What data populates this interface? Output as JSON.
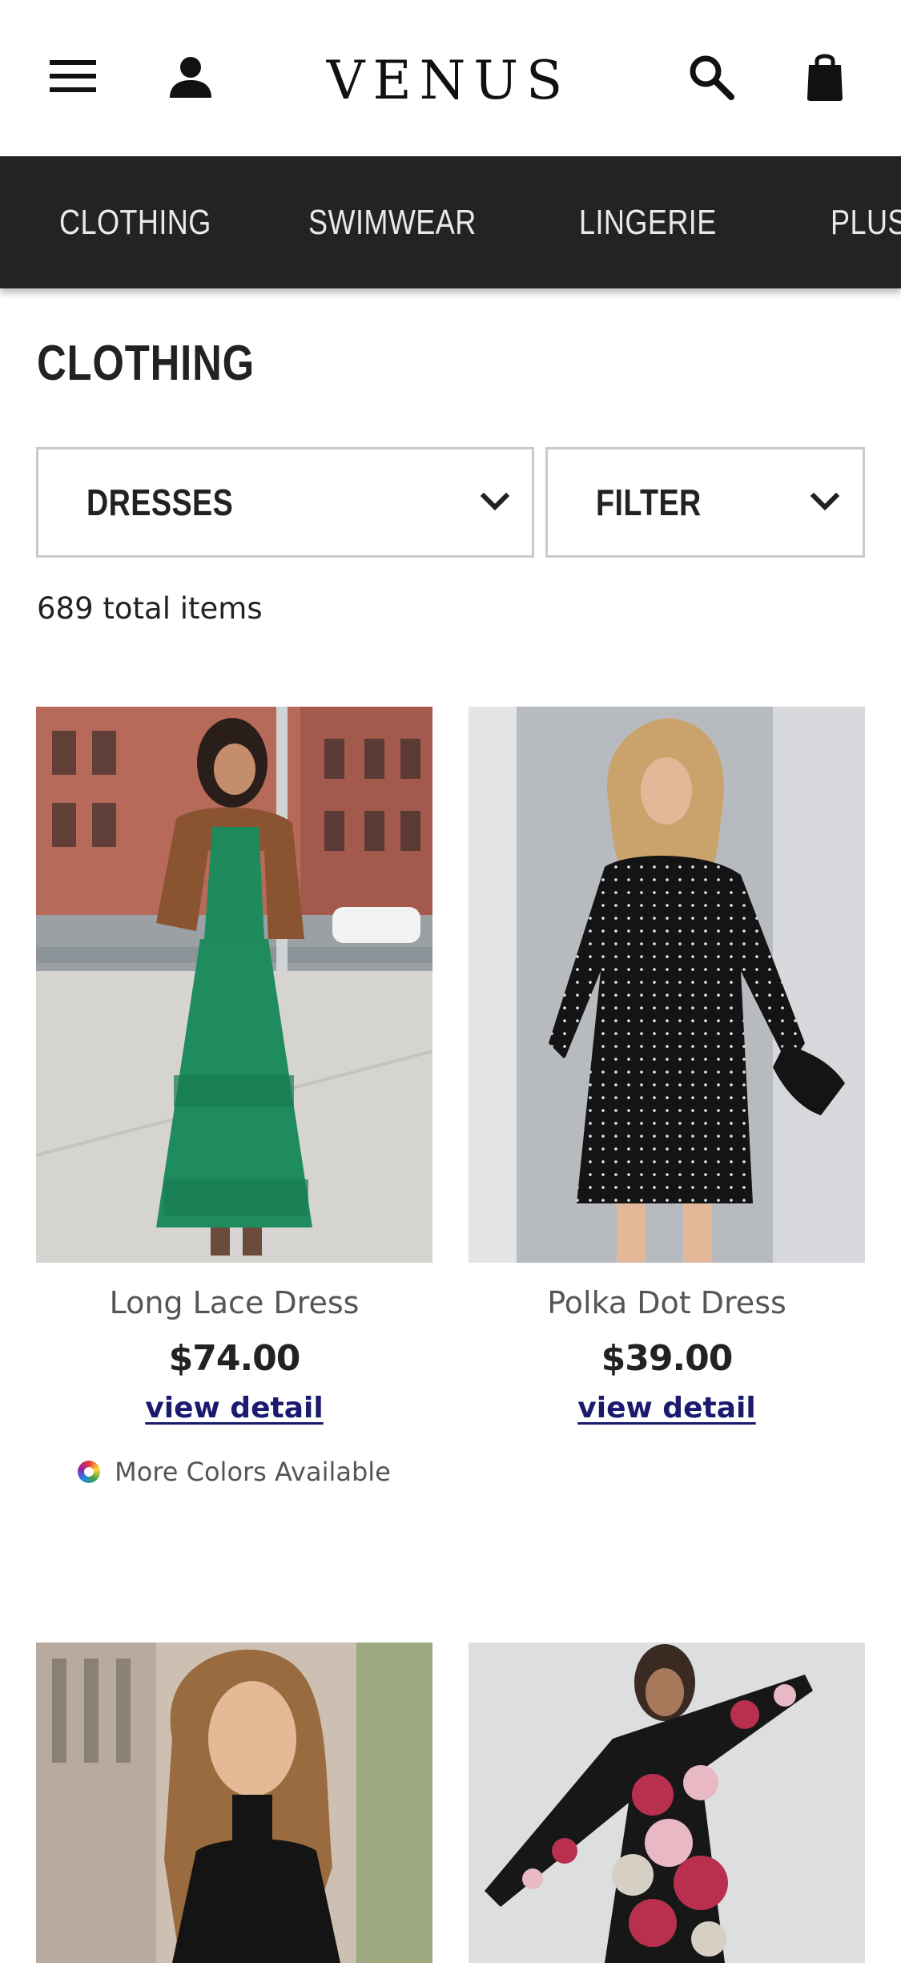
{
  "header": {
    "logo_text": "VENUS",
    "icons": {
      "menu": "menu-icon",
      "account": "account-icon",
      "search": "search-icon",
      "bag": "shopping-bag-icon"
    }
  },
  "category_nav": {
    "items": [
      {
        "label": "CLOTHING"
      },
      {
        "label": "SWIMWEAR"
      },
      {
        "label": "LINGERIE"
      },
      {
        "label": "PLUS"
      }
    ],
    "background": "#232323"
  },
  "page": {
    "title": "CLOTHING",
    "total_items": "689 total items"
  },
  "filters": {
    "category_select": {
      "value": "DRESSES"
    },
    "filter_select": {
      "value": "FILTER"
    }
  },
  "products": [
    {
      "name": "Long Lace Dress",
      "price": "$74.00",
      "link_label": "view detail",
      "more_colors": "More Colors Available"
    },
    {
      "name": "Polka Dot Dress",
      "price": "$39.00",
      "link_label": "view detail"
    },
    {
      "name": "",
      "price": "",
      "link_label": ""
    },
    {
      "name": "",
      "price": "",
      "link_label": ""
    }
  ],
  "colors": {
    "link": "#1a1a6e",
    "nav_text": "#e9e9e9",
    "border": "#c9c9c9"
  }
}
